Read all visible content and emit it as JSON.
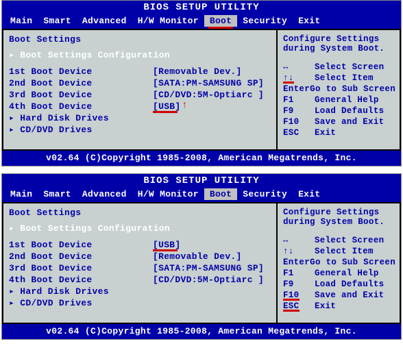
{
  "screen1": {
    "title": "BIOS SETUP UTILITY",
    "menu": {
      "items": [
        "Main",
        "Smart",
        "Advanced",
        "H/W Monitor",
        "Boot",
        "Security",
        "Exit"
      ],
      "selected": "Boot",
      "underline": "Boot"
    },
    "heading": "Boot Settings",
    "config_line": "▸ Boot Settings Configuration",
    "devices": [
      {
        "label": "1st Boot Device",
        "value": "[Removable Dev.]"
      },
      {
        "label": "2nd Boot Device",
        "value": "[SATA:PM-SAMSUNG SP]"
      },
      {
        "label": "3rd Boot Device",
        "value": "[CD/DVD:5M-Optiarc ]"
      },
      {
        "label": "4th Boot Device",
        "value": "[USB]",
        "underline": true,
        "arrow": "↑"
      }
    ],
    "submenus": [
      "▸ Hard Disk Drives",
      "▸ CD/DVD Drives"
    ],
    "help": {
      "title1": "Configure Settings",
      "title2": "during System Boot.",
      "lines": [
        {
          "key": "↔",
          "desc": "Select Screen"
        },
        {
          "key": "↑↓",
          "desc": "Select Item",
          "key_underline": true
        },
        {
          "key": "Enter",
          "desc": "Go to Sub Screen"
        },
        {
          "key": "F1",
          "desc": "General Help"
        },
        {
          "key": "F9",
          "desc": "Load Defaults"
        },
        {
          "key": "F10",
          "desc": "Save and Exit"
        },
        {
          "key": "ESC",
          "desc": "Exit"
        }
      ]
    },
    "footer": "v02.64 (C)Copyright 1985-2008, American Megatrends, Inc."
  },
  "screen2": {
    "title": "BIOS SETUP UTILITY",
    "menu": {
      "items": [
        "Main",
        "Smart",
        "Advanced",
        "H/W Monitor",
        "Boot",
        "Security",
        "Exit"
      ],
      "selected": "Boot"
    },
    "heading": "Boot Settings",
    "config_line": "▸ Boot Settings Configuration",
    "devices": [
      {
        "label": "1st Boot Device",
        "value": "[USB]",
        "underline": true
      },
      {
        "label": "2nd Boot Device",
        "value": "[Removable Dev.]"
      },
      {
        "label": "3rd Boot Device",
        "value": "[SATA:PM-SAMSUNG SP]"
      },
      {
        "label": "4th Boot Device",
        "value": "[CD/DVD:5M-Optiarc ]"
      }
    ],
    "submenus": [
      "▸ Hard Disk Drives",
      "▸ CD/DVD Drives"
    ],
    "help": {
      "title1": "Configure Settings",
      "title2": "during System Boot.",
      "lines": [
        {
          "key": "↔",
          "desc": "Select Screen"
        },
        {
          "key": "↑↓",
          "desc": "Select Item"
        },
        {
          "key": "Enter",
          "desc": "Go to Sub Screen"
        },
        {
          "key": "F1",
          "desc": "General Help"
        },
        {
          "key": "F9",
          "desc": "Load Defaults"
        },
        {
          "key": "F10",
          "desc": "Save and Exit",
          "key_underline": true
        },
        {
          "key": "ESC",
          "desc": "Exit",
          "key_underline": true
        }
      ]
    },
    "footer": "v02.64 (C)Copyright 1985-2008, American Megatrends, Inc."
  }
}
